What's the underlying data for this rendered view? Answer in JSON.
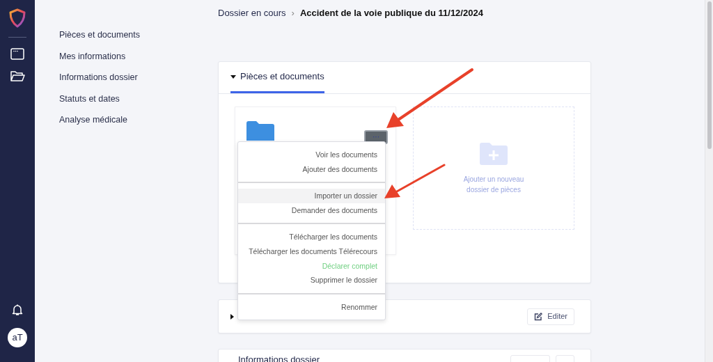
{
  "rail": {
    "avatar": "aT"
  },
  "sidebar_nav": [
    "Pièces et documents",
    "Mes informations",
    "Informations dossier",
    "Statuts et dates",
    "Analyse médicale"
  ],
  "breadcrumb": {
    "parent": "Dossier en cours",
    "separator": "›",
    "current": "Accident de la voie publique du 11/12/2024"
  },
  "documents_panel": {
    "tab": "Pièces et documents",
    "expanded": true,
    "menu_button": "···",
    "add_tile": "Ajouter un nouveau dossier de pièces",
    "menu": [
      [
        {
          "label": "Voir les documents",
          "kind": "normal",
          "highlighted": false
        },
        {
          "label": "Ajouter des documents",
          "kind": "normal",
          "highlighted": false
        }
      ],
      [
        {
          "label": "Importer un dossier",
          "kind": "normal",
          "highlighted": true
        },
        {
          "label": "Demander des documents",
          "kind": "normal",
          "highlighted": false
        }
      ],
      [
        {
          "label": "Télécharger les documents",
          "kind": "normal",
          "highlighted": false
        },
        {
          "label": "Télécharger les documents Télérecours",
          "kind": "normal",
          "highlighted": false
        },
        {
          "label": "Déclarer complet",
          "kind": "success",
          "highlighted": false
        },
        {
          "label": "Supprimer le dossier",
          "kind": "normal",
          "highlighted": false
        }
      ],
      [
        {
          "label": "Renommer",
          "kind": "normal",
          "highlighted": false
        }
      ]
    ]
  },
  "collapsed_panel": {
    "expanded": false,
    "button": "Editer"
  },
  "info_panel": {
    "title": "Informations dossier"
  }
}
